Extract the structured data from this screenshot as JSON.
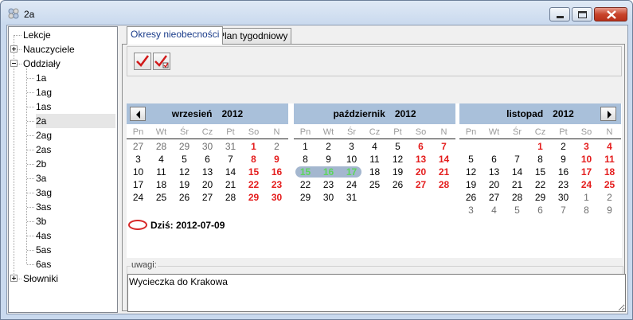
{
  "window": {
    "title": "2a"
  },
  "tree": {
    "items": [
      {
        "label": "Lekcje",
        "level": 0,
        "expander": "none"
      },
      {
        "label": "Nauczyciele",
        "level": 0,
        "expander": "plus"
      },
      {
        "label": "Oddziały",
        "level": 0,
        "expander": "minus"
      },
      {
        "label": "1a",
        "level": 1
      },
      {
        "label": "1ag",
        "level": 1
      },
      {
        "label": "1as",
        "level": 1
      },
      {
        "label": "2a",
        "level": 1,
        "selected": true
      },
      {
        "label": "2ag",
        "level": 1
      },
      {
        "label": "2as",
        "level": 1
      },
      {
        "label": "2b",
        "level": 1
      },
      {
        "label": "3a",
        "level": 1
      },
      {
        "label": "3ag",
        "level": 1
      },
      {
        "label": "3as",
        "level": 1
      },
      {
        "label": "3b",
        "level": 1
      },
      {
        "label": "4as",
        "level": 1
      },
      {
        "label": "5as",
        "level": 1
      },
      {
        "label": "6as",
        "level": 1
      },
      {
        "label": "Słowniki",
        "level": 0,
        "expander": "plus"
      }
    ]
  },
  "tabs": [
    {
      "label": "Okresy nieobecności",
      "active": true
    },
    {
      "label": "Plan tygodniowy",
      "active": false
    }
  ],
  "toolbar": {
    "icons": [
      "checkmark-icon",
      "double-checkmark-icon"
    ]
  },
  "calendar": {
    "weekdays": [
      "Pn",
      "Wt",
      "Śr",
      "Cz",
      "Pt",
      "So",
      "N"
    ],
    "months": [
      {
        "name": "wrzesień",
        "year": "2012",
        "weeks": [
          [
            [
              "27",
              "other"
            ],
            [
              "28",
              "other"
            ],
            [
              "29",
              "other"
            ],
            [
              "30",
              "other"
            ],
            [
              "31",
              "other"
            ],
            [
              "1",
              "weekend"
            ],
            [
              "2",
              "other"
            ]
          ],
          [
            [
              "3",
              ""
            ],
            [
              "4",
              ""
            ],
            [
              "5",
              ""
            ],
            [
              "6",
              ""
            ],
            [
              "7",
              ""
            ],
            [
              "8",
              "weekend"
            ],
            [
              "9",
              "weekend"
            ]
          ],
          [
            [
              "10",
              ""
            ],
            [
              "11",
              ""
            ],
            [
              "12",
              ""
            ],
            [
              "13",
              ""
            ],
            [
              "14",
              ""
            ],
            [
              "15",
              "weekend"
            ],
            [
              "16",
              "weekend"
            ]
          ],
          [
            [
              "17",
              ""
            ],
            [
              "18",
              ""
            ],
            [
              "19",
              ""
            ],
            [
              "20",
              ""
            ],
            [
              "21",
              ""
            ],
            [
              "22",
              "weekend"
            ],
            [
              "23",
              "weekend"
            ]
          ],
          [
            [
              "24",
              ""
            ],
            [
              "25",
              ""
            ],
            [
              "26",
              ""
            ],
            [
              "27",
              ""
            ],
            [
              "28",
              ""
            ],
            [
              "29",
              "weekend"
            ],
            [
              "30",
              "weekend"
            ]
          ]
        ]
      },
      {
        "name": "październik",
        "year": "2012",
        "weeks": [
          [
            [
              "1",
              ""
            ],
            [
              "2",
              ""
            ],
            [
              "3",
              ""
            ],
            [
              "4",
              ""
            ],
            [
              "5",
              ""
            ],
            [
              "6",
              "weekend"
            ],
            [
              "7",
              "weekend"
            ]
          ],
          [
            [
              "8",
              ""
            ],
            [
              "9",
              ""
            ],
            [
              "10",
              ""
            ],
            [
              "11",
              ""
            ],
            [
              "12",
              ""
            ],
            [
              "13",
              "weekend"
            ],
            [
              "14",
              "weekend"
            ]
          ],
          [
            [
              "15",
              "holiday"
            ],
            [
              "16",
              "holiday"
            ],
            [
              "17",
              "holiday"
            ],
            [
              "18",
              ""
            ],
            [
              "19",
              ""
            ],
            [
              "20",
              "weekend"
            ],
            [
              "21",
              "weekend"
            ]
          ],
          [
            [
              "22",
              ""
            ],
            [
              "23",
              ""
            ],
            [
              "24",
              ""
            ],
            [
              "25",
              ""
            ],
            [
              "26",
              ""
            ],
            [
              "27",
              "weekend"
            ],
            [
              "28",
              "weekend"
            ]
          ],
          [
            [
              "29",
              ""
            ],
            [
              "30",
              ""
            ],
            [
              "31",
              ""
            ]
          ]
        ]
      },
      {
        "name": "listopad",
        "year": "2012",
        "weeks": [
          [
            null,
            null,
            null,
            [
              "1",
              "weekend"
            ],
            [
              "2",
              ""
            ],
            [
              "3",
              "weekend"
            ],
            [
              "4",
              "weekend"
            ]
          ],
          [
            [
              "5",
              ""
            ],
            [
              "6",
              ""
            ],
            [
              "7",
              ""
            ],
            [
              "8",
              ""
            ],
            [
              "9",
              ""
            ],
            [
              "10",
              "weekend"
            ],
            [
              "11",
              "weekend"
            ]
          ],
          [
            [
              "12",
              ""
            ],
            [
              "13",
              ""
            ],
            [
              "14",
              ""
            ],
            [
              "15",
              ""
            ],
            [
              "16",
              ""
            ],
            [
              "17",
              "weekend"
            ],
            [
              "18",
              "weekend"
            ]
          ],
          [
            [
              "19",
              ""
            ],
            [
              "20",
              ""
            ],
            [
              "21",
              ""
            ],
            [
              "22",
              ""
            ],
            [
              "23",
              ""
            ],
            [
              "24",
              "weekend"
            ],
            [
              "25",
              "weekend"
            ]
          ],
          [
            [
              "26",
              ""
            ],
            [
              "27",
              ""
            ],
            [
              "28",
              ""
            ],
            [
              "29",
              ""
            ],
            [
              "30",
              ""
            ],
            [
              "1",
              "other"
            ],
            [
              "2",
              "other"
            ]
          ],
          [
            [
              "3",
              "other"
            ],
            [
              "4",
              "other"
            ],
            [
              "5",
              "other"
            ],
            [
              "6",
              "other"
            ],
            [
              "7",
              "other"
            ],
            [
              "8",
              "other"
            ],
            [
              "9",
              "other"
            ]
          ]
        ]
      }
    ],
    "today_label": "Dziś:",
    "today_value": "2012-07-09"
  },
  "notes": {
    "label": "uwagi:",
    "value": "Wycieczka do Krakowa"
  },
  "colors": {
    "weekend": "#e41d1d",
    "holiday": "#5cd65c",
    "month_header": "#a9c0da",
    "today_ring": "#d62828"
  }
}
